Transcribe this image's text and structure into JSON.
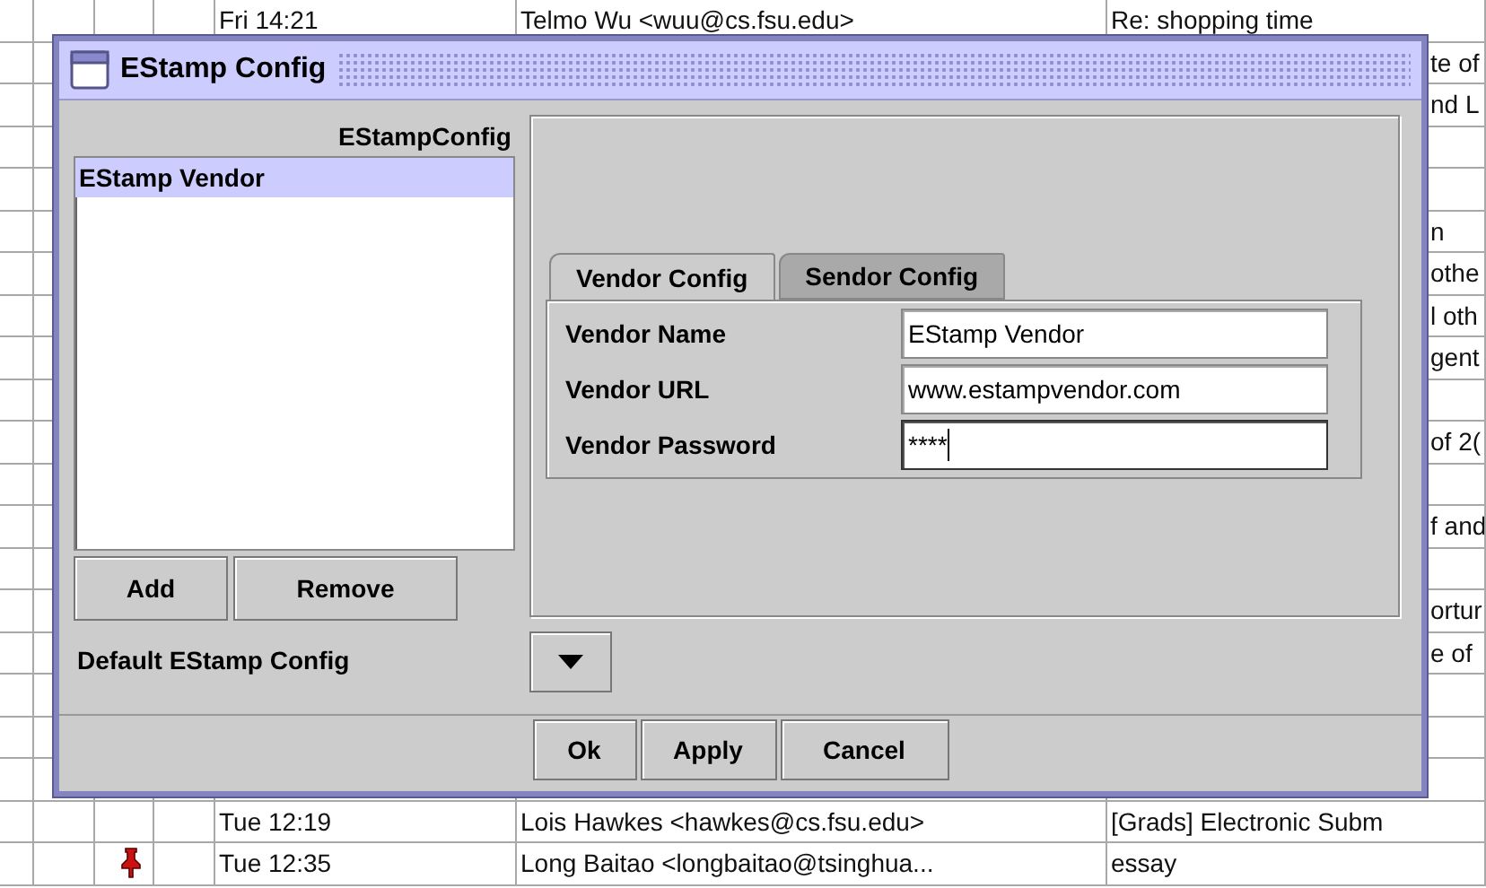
{
  "mail_list": {
    "rows": [
      {
        "kind": "full",
        "time": "Fri 14:21",
        "sender": "Telmo Wu <wuu@cs.fsu.edu>",
        "subject": "Re: shopping time",
        "pinned": false
      },
      {
        "kind": "fragment",
        "subject": "te of"
      },
      {
        "kind": "fragment",
        "subject": "nd L"
      },
      {
        "kind": "empty"
      },
      {
        "kind": "empty"
      },
      {
        "kind": "fragment",
        "subject": "n"
      },
      {
        "kind": "fragment",
        "subject": "othe"
      },
      {
        "kind": "fragment",
        "subject": "l oth"
      },
      {
        "kind": "fragment",
        "subject": "gent"
      },
      {
        "kind": "empty"
      },
      {
        "kind": "fragment",
        "subject": "of 2("
      },
      {
        "kind": "empty"
      },
      {
        "kind": "fragment",
        "subject": "f and"
      },
      {
        "kind": "empty"
      },
      {
        "kind": "fragment",
        "subject": "ortur"
      },
      {
        "kind": "fragment",
        "subject": "e of"
      },
      {
        "kind": "empty"
      },
      {
        "kind": "empty"
      },
      {
        "kind": "empty"
      },
      {
        "kind": "full",
        "time": "Tue 12:19",
        "sender": "Lois Hawkes <hawkes@cs.fsu.edu>",
        "subject": "[Grads] Electronic Subm",
        "pinned": false
      },
      {
        "kind": "full",
        "time": "Tue 12:35",
        "sender": "Long Baitao <longbaitao@tsinghua...",
        "subject": "essay",
        "pinned": true
      }
    ]
  },
  "dialog": {
    "title": "EStamp Config",
    "list_header": "EStampConfig",
    "list_items": [
      {
        "label": "EStamp Vendor",
        "selected": true
      }
    ],
    "list_buttons": [
      "Add",
      "Remove"
    ],
    "default_label": "Default EStamp Config",
    "tabs": [
      {
        "label": "Vendor Config",
        "selected": true
      },
      {
        "label": "Sendor Config",
        "selected": false
      }
    ],
    "fields": [
      {
        "label": "Vendor Name",
        "value": "EStamp Vendor",
        "focused": false
      },
      {
        "label": "Vendor URL",
        "value": "www.estampvendor.com",
        "focused": false
      },
      {
        "label": "Vendor Password",
        "value": "****",
        "focused": true
      }
    ],
    "buttons": [
      "Ok",
      "Apply",
      "Cancel"
    ]
  }
}
